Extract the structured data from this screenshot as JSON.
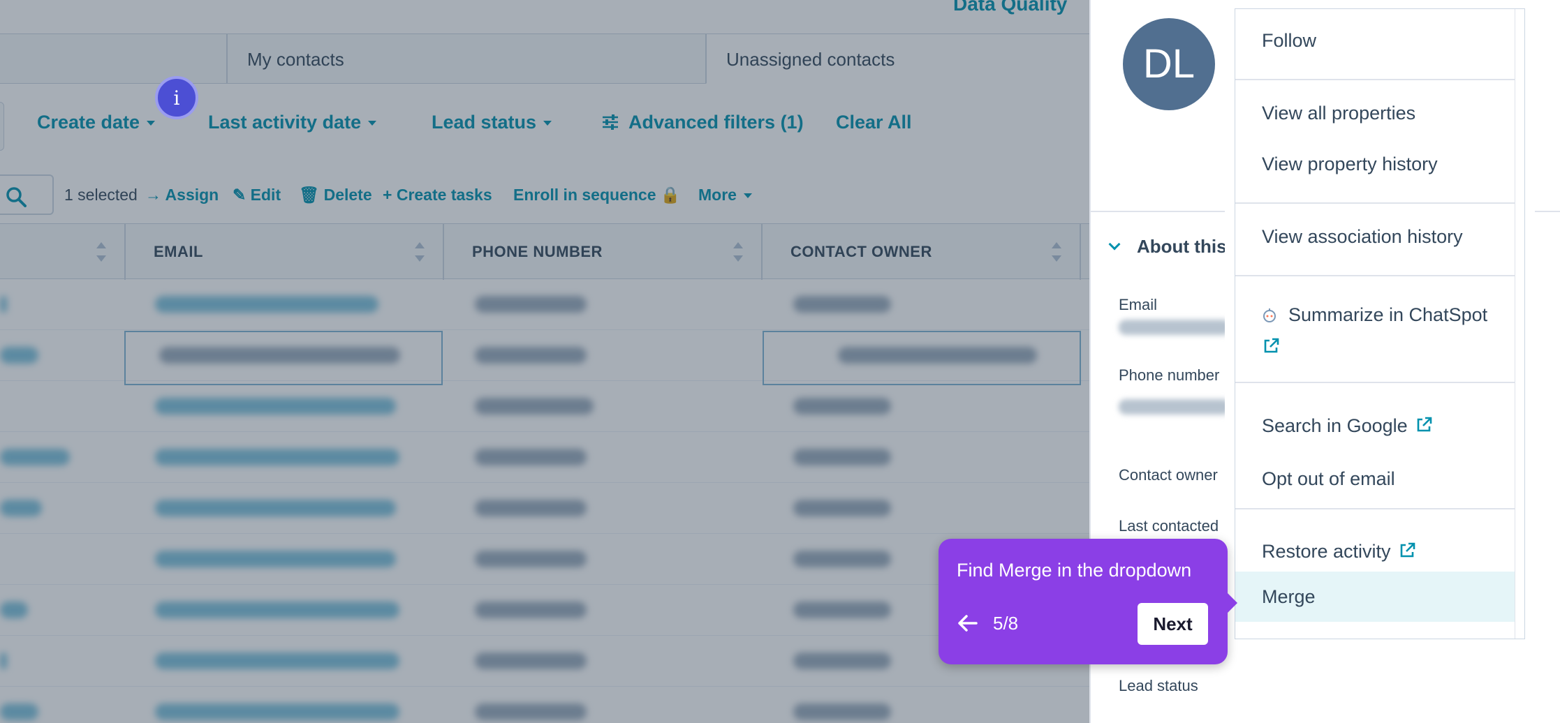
{
  "app": {
    "top_link": "Data Quality",
    "view_tabs": [
      "",
      "My contacts",
      "Unassigned contacts"
    ],
    "filters": {
      "create_date": "Create date",
      "last_activity_date": "Last activity date",
      "lead_status": "Lead status",
      "advanced_filters": "Advanced filters (1)",
      "clear_all": "Clear All"
    },
    "info_badge": "i",
    "toolbar": {
      "selected_count": "1 selected",
      "assign": "Assign",
      "edit": "Edit",
      "delete": "Delete",
      "create_tasks": "Create tasks",
      "enroll_in_sequence": "Enroll in sequence",
      "more": "More"
    },
    "table": {
      "columns": [
        "",
        "EMAIL",
        "PHONE NUMBER",
        "CONTACT OWNER"
      ]
    }
  },
  "panel": {
    "avatar_initials": "DL",
    "section_title": "About this",
    "properties": {
      "email_label": "Email",
      "phone_label": "Phone number",
      "owner_label": "Contact owner",
      "last_contacted_label": "Last contacted",
      "lead_status_label": "Lead status"
    }
  },
  "dropdown": {
    "follow": "Follow",
    "view_all_properties": "View all properties",
    "view_property_history": "View property history",
    "view_association_history": "View association history",
    "summarize_chatspot": "Summarize in ChatSpot",
    "search_google": "Search in Google",
    "opt_out_email": "Opt out of email",
    "restore_activity": "Restore activity",
    "merge": "Merge"
  },
  "tour": {
    "message": "Find Merge in the dropdown",
    "step": "5/8",
    "next_label": "Next"
  },
  "colors": {
    "accent": "#0091ae",
    "tour_purple": "#8b3fe6",
    "highlight": "#e5f5f8"
  }
}
